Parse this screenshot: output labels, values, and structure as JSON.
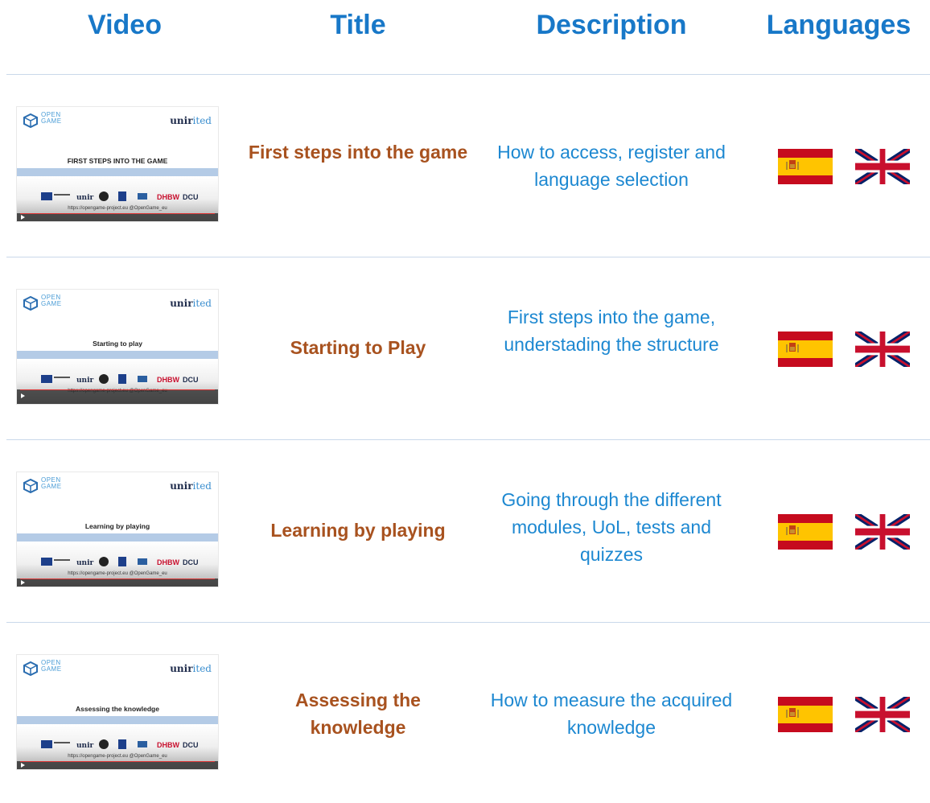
{
  "headers": {
    "video": "Video",
    "title": "Title",
    "description": "Description",
    "languages": "Languages"
  },
  "colors": {
    "header_blue": "#1878c8",
    "title_brown": "#a8521f",
    "desc_blue": "#1d88d1",
    "rule": "#c9d8ea"
  },
  "thumbnail_common": {
    "logo_text_1": "OPEN",
    "logo_text_2": "GAME",
    "brand_left": "unir",
    "brand_right": "ited",
    "url": "https://opengame-project.eu   @OpenGame_eu"
  },
  "rows": [
    {
      "thumb_title": "FIRST STEPS INTO THE GAME",
      "title": "First steps into the game",
      "description": "How to access, register and language selection",
      "languages": [
        "es-flag-icon",
        "uk-flag-icon"
      ]
    },
    {
      "thumb_title": "Starting to play",
      "title": "Starting to Play",
      "description": "First steps into the game, understading the structure",
      "languages": [
        "es-flag-icon",
        "uk-flag-icon"
      ]
    },
    {
      "thumb_title": "Learning by playing",
      "title": "Learning by playing",
      "description": "Going through the different modules, UoL, tests and quizzes",
      "languages": [
        "es-flag-icon",
        "uk-flag-icon"
      ]
    },
    {
      "thumb_title": "Assessing the knowledge",
      "title": "Assessing the knowledge",
      "description": "How to measure the acquired knowledge",
      "languages": [
        "es-flag-icon",
        "uk-flag-icon"
      ]
    }
  ]
}
